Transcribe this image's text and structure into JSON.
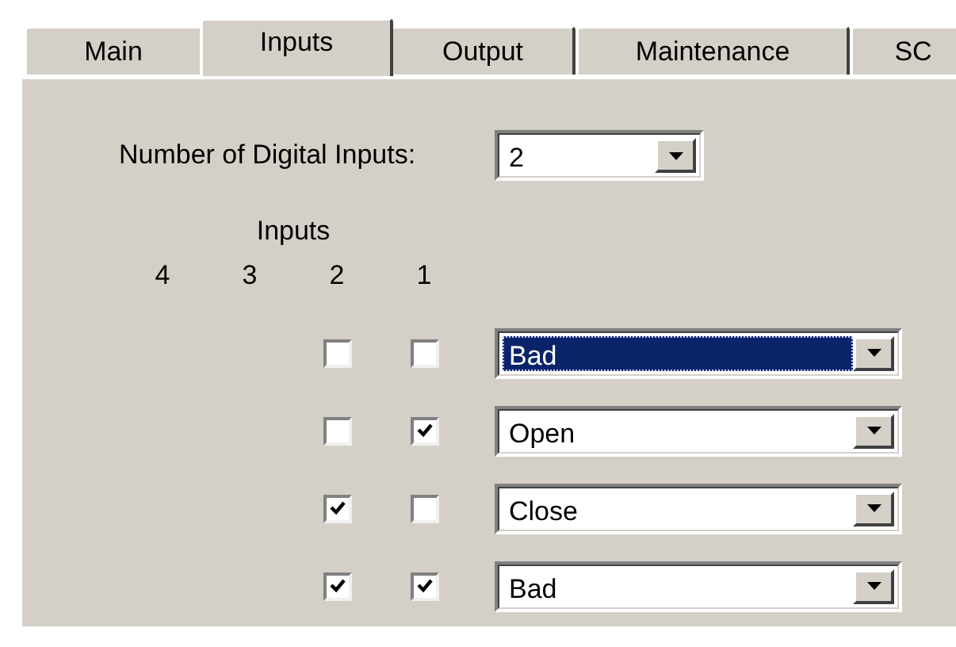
{
  "tabs": [
    {
      "label": "Main",
      "selected": false
    },
    {
      "label": "Inputs",
      "selected": true
    },
    {
      "label": "Output",
      "selected": false
    },
    {
      "label": "Maintenance",
      "selected": false
    },
    {
      "label": "SC",
      "selected": false
    }
  ],
  "digital_inputs": {
    "label": "Number of Digital Inputs:",
    "value": "2"
  },
  "inputs_header": "Inputs",
  "input_numbers": [
    "4",
    "3",
    "2",
    "1"
  ],
  "rows": [
    {
      "checks": [
        false,
        false
      ],
      "state": "Bad",
      "selected": true
    },
    {
      "checks": [
        false,
        true
      ],
      "state": "Open",
      "selected": false
    },
    {
      "checks": [
        true,
        false
      ],
      "state": "Close",
      "selected": false
    },
    {
      "checks": [
        true,
        true
      ],
      "state": "Bad",
      "selected": false
    }
  ]
}
